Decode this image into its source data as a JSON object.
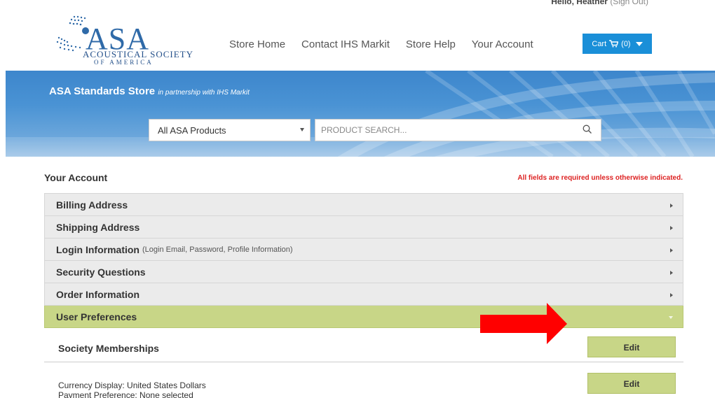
{
  "header": {
    "greeting_prefix": "Hello, Heather",
    "sign_out": "(Sign Out)",
    "logo": {
      "mark": "ASA",
      "line1": "ACOUSTICAL SOCIETY",
      "line2": "OF AMERICA"
    },
    "nav": [
      "Store Home",
      "Contact IHS Markit",
      "Store Help",
      "Your Account"
    ],
    "cart_label": "Cart",
    "cart_count": "(0)"
  },
  "banner": {
    "title": "ASA Standards Store",
    "subtitle": "in partnership with IHS Markit",
    "category_selected": "All ASA Products",
    "search_placeholder": "PRODUCT SEARCH..."
  },
  "account": {
    "title": "Your Account",
    "required_note": "All fields are required unless otherwise indicated.",
    "sections": [
      {
        "label": "Billing Address",
        "hint": ""
      },
      {
        "label": "Shipping Address",
        "hint": ""
      },
      {
        "label": "Login Information",
        "hint": "(Login Email, Password, Profile Information)"
      },
      {
        "label": "Security Questions",
        "hint": ""
      },
      {
        "label": "Order Information",
        "hint": ""
      },
      {
        "label": "User Preferences",
        "hint": ""
      }
    ],
    "preferences": {
      "memberships_label": "Society Memberships",
      "edit_label": "Edit",
      "currency_line": "Currency Display: United States Dollars",
      "payment_line": "Payment Preference: None selected"
    }
  },
  "colors": {
    "accent_green": "#c8d687",
    "cart_blue": "#1a8fd8",
    "required_red": "#dd2222",
    "annotation_arrow": "#ff0000"
  },
  "icons": {
    "search": "search-icon",
    "cart": "shopping-cart-icon",
    "arrow": "red-arrow-annotation"
  }
}
